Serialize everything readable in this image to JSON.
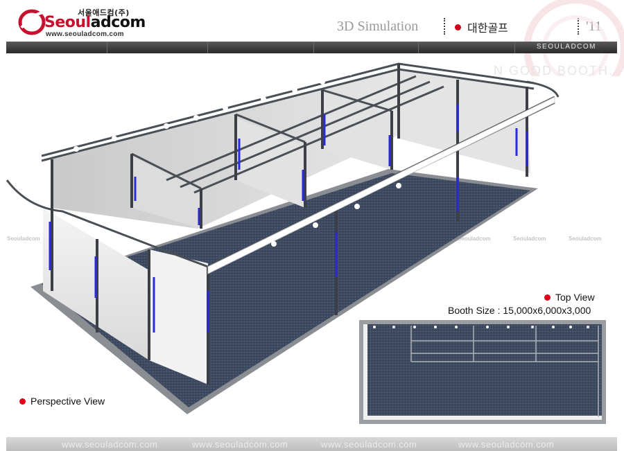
{
  "header": {
    "logo_korean": "서울애드컴(주)",
    "logo_brand_part1": "Seoul",
    "logo_brand_part2": "adcom",
    "logo_url": "www.seouladcom.com",
    "page_title": "3D Simulation",
    "client_name": "대한골프",
    "year": "'11"
  },
  "navbar": {
    "brand": "SEOULADCOM"
  },
  "background_text": "N GOOD BOOTH.",
  "watermark": {
    "korean": "서울애드컴(주)",
    "brand": "Seouladcom",
    "url": "www.seouladcom.com"
  },
  "labels": {
    "top_view": "Top View",
    "booth_size": "Booth Size : 15,000x6,000x3,000",
    "perspective_view": "Perspective View"
  },
  "footer": {
    "links": [
      "www.seouladcom.com",
      "www.seouladcom.com",
      "www.seouladcom.com",
      "www.seouladcom.com"
    ]
  },
  "colors": {
    "brand_red": "#c8102e",
    "accent_dot": "#e0001b",
    "carpet": "#3d4a5e",
    "truss": "#4a4f55",
    "light_bar": "#2a2ad8"
  }
}
